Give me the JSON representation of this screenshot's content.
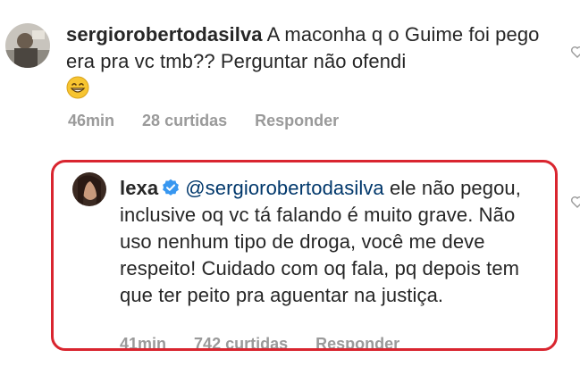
{
  "comments": [
    {
      "username": "sergiorobertodasilva",
      "text": "A maconha q o Guime foi pego era pra vc tmb?? Perguntar não ofendi",
      "emoji": "grinning-face-with-smiling-eyes",
      "time": "46min",
      "likes": "28 curtidas",
      "reply": "Responder"
    },
    {
      "username": "lexa",
      "verified": true,
      "mention": "@sergiorobertodasilva",
      "text": "ele não pegou, inclusive oq vc tá falando é muito grave. Não uso nenhum tipo de droga, você me deve respeito! Cuidado com oq fala, pq depois tem que ter peito pra aguentar na justiça.",
      "time": "41min",
      "likes": "742 curtidas",
      "reply": "Responder"
    }
  ],
  "colors": {
    "highlight": "#d9252f",
    "verified": "#3897f0",
    "mention": "#00376b",
    "meta": "#9a9a9a"
  }
}
